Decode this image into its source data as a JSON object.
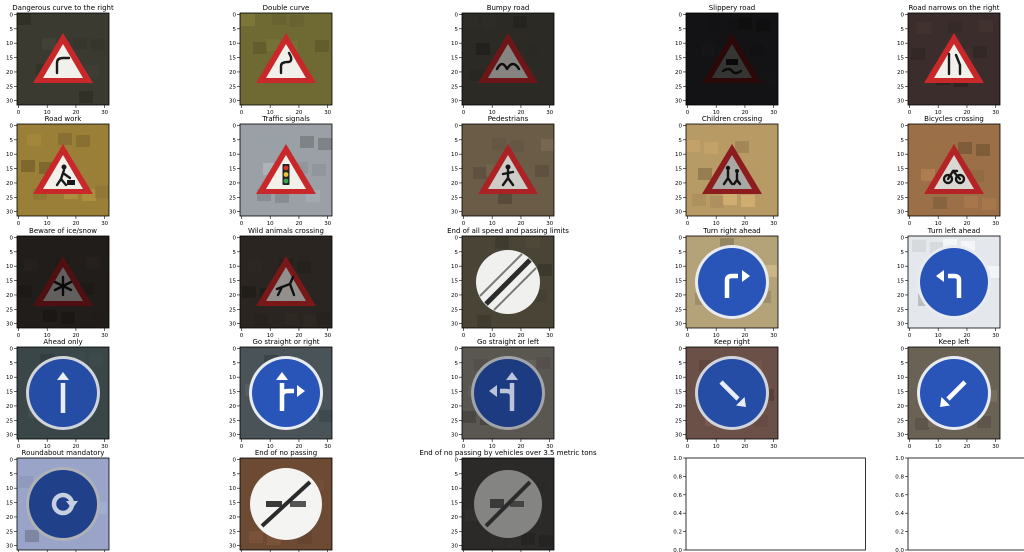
{
  "figure": {
    "layout": "5x5 grid of image subplots",
    "background": "#ffffff"
  },
  "chart_data": {
    "type": "image_grid",
    "image_axis": {
      "xticks": [
        0,
        10,
        20,
        30
      ],
      "yticks": [
        0,
        5,
        10,
        15,
        20,
        25,
        30
      ],
      "xlim": [
        0,
        32
      ],
      "ylim": [
        32,
        0
      ]
    },
    "empty_axis": {
      "xticks": [
        "0.0",
        "0.2",
        "0.4",
        "0.6",
        "0.8",
        "1.0"
      ],
      "yticks": [
        "0.0",
        "0.2",
        "0.4",
        "0.6",
        "0.8",
        "1.0"
      ],
      "xlim": [
        0,
        1
      ],
      "ylim": [
        0,
        1
      ]
    },
    "panels": [
      {
        "title": "Dangerous curve to the right",
        "kind": "triangle",
        "symbol": "curve",
        "bg": "#3b3a30",
        "bright": 1.0
      },
      {
        "title": "Double curve",
        "kind": "triangle",
        "symbol": "dcurve",
        "bg": "#6f6a34",
        "bright": 1.0
      },
      {
        "title": "Bumpy road",
        "kind": "triangle",
        "symbol": "bumps",
        "bg": "#2b2a24",
        "bright": 0.55
      },
      {
        "title": "Slippery road",
        "kind": "triangle",
        "symbol": "car",
        "bg": "#131214",
        "bright": 0.22
      },
      {
        "title": "Road narrows on the right",
        "kind": "triangle",
        "symbol": "narrow",
        "bg": "#3a2d2b",
        "bright": 1.0
      },
      {
        "title": "Road work",
        "kind": "triangle",
        "symbol": "worker",
        "bg": "#9a7f38",
        "bright": 1.0
      },
      {
        "title": "Traffic signals",
        "kind": "triangle",
        "symbol": "lights",
        "bg": "#9aa0a6",
        "bright": 1.0
      },
      {
        "title": "Pedestrians",
        "kind": "triangle",
        "symbol": "ped",
        "bg": "#6b5c48",
        "bright": 0.85
      },
      {
        "title": "Children crossing",
        "kind": "triangle",
        "symbol": "children",
        "bg": "#b89a64",
        "bright": 0.7
      },
      {
        "title": "Bicycles crossing",
        "kind": "triangle",
        "symbol": "bike",
        "bg": "#9b7048",
        "bright": 0.9
      },
      {
        "title": "Beware of ice/snow",
        "kind": "triangle",
        "symbol": "snow",
        "bg": "#211d1b",
        "bright": 0.4
      },
      {
        "title": "Wild animals crossing",
        "kind": "triangle",
        "symbol": "deer",
        "bg": "#2a2520",
        "bright": 0.6
      },
      {
        "title": "End of all speed and passing limits",
        "kind": "endall",
        "symbol": "",
        "bg": "#4a4436",
        "bright": 1.0
      },
      {
        "title": "Turn right ahead",
        "kind": "blue",
        "symbol": "turn-right",
        "bg": "#b4a278",
        "bright": 1.0
      },
      {
        "title": "Turn left ahead",
        "kind": "blue",
        "symbol": "turn-left",
        "bg": "#e4e8ec",
        "bright": 1.0
      },
      {
        "title": "Ahead only",
        "kind": "blue",
        "symbol": "ahead",
        "bg": "#3a4648",
        "bright": 0.9
      },
      {
        "title": "Go straight or right",
        "kind": "blue",
        "symbol": "straight-right",
        "bg": "#4a5458",
        "bright": 1.0
      },
      {
        "title": "Go straight or left",
        "kind": "blue",
        "symbol": "straight-left",
        "bg": "#5a5650",
        "bright": 0.7
      },
      {
        "title": "Keep right",
        "kind": "blue",
        "symbol": "keep-right",
        "bg": "#6b5048",
        "bright": 0.9
      },
      {
        "title": "Keep left",
        "kind": "blue",
        "symbol": "keep-left",
        "bg": "#6b6256",
        "bright": 1.0
      },
      {
        "title": "Roundabout mandatory",
        "kind": "blue",
        "symbol": "roundabout",
        "bg": "#9aa4c8",
        "bright": 0.75
      },
      {
        "title": "End of no passing",
        "kind": "endpass",
        "symbol": "",
        "bg": "#6c4a34",
        "bright": 1.0
      },
      {
        "title": "End of no passing by vehicles over 3.5 metric tons",
        "kind": "endtruck",
        "symbol": "",
        "bg": "#2c2a28",
        "bright": 0.55
      },
      {
        "title": "",
        "kind": "empty",
        "symbol": "",
        "bg": "#ffffff",
        "bright": 1.0
      },
      {
        "title": "",
        "kind": "empty",
        "symbol": "",
        "bg": "#ffffff",
        "bright": 1.0
      }
    ]
  }
}
